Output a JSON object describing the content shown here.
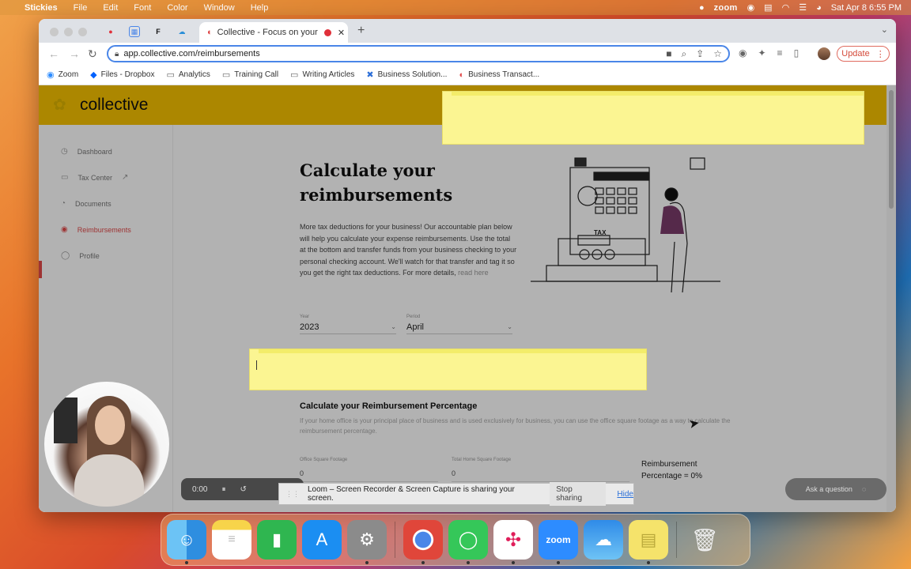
{
  "menubar": {
    "app": "Stickies",
    "items": [
      "File",
      "Edit",
      "Font",
      "Color",
      "Window",
      "Help"
    ],
    "zoom": "zoom",
    "datetime": "Sat Apr 8  6:55 PM"
  },
  "browser": {
    "tab_title": "Collective - Focus on your",
    "url": "app.collective.com/reimbursements",
    "update_label": "Update",
    "bookmarks": [
      "Zoom",
      "Files - Dropbox",
      "Analytics",
      "Training Call",
      "Writing Articles",
      "Business Solution...",
      "Business Transact..."
    ]
  },
  "app": {
    "logo": "collective",
    "nav": [
      "Dashboard",
      "Tax Center",
      "Documents",
      "Reimbursements",
      "Profile"
    ],
    "heading": "Calculate your reimbursements",
    "intro": "More tax deductions for your business! Our accountable plan below will help you calculate your expense reimbursements. Use the total at the bottom and transfer funds from your business checking to your personal checking account. We'll watch for that transfer and tag it so you get the right tax deductions. For more details,",
    "intro_link": "read here",
    "year_label": "Year",
    "year_value": "2023",
    "period_label": "Period",
    "period_value": "April",
    "section_title": "Calculate your Reimbursement Percentage",
    "section_text": "If your home office is your principal place of business and is used exclusively for business, you can use the office square footage as a way to calculate the reimbursement percentage.",
    "office_label": "Office Square Footage",
    "office_value": "0",
    "home_label": "Total Home Square Footage",
    "home_value": "0",
    "reimb_label": "Reimbursement",
    "reimb_value": "Percentage = 0%",
    "ask_label": "Ask a question"
  },
  "loom": {
    "time": "0:00",
    "message": "Loom – Screen Recorder & Screen Capture is sharing your screen.",
    "stop_label": "Stop sharing",
    "hide_label": "Hide"
  },
  "dock": {
    "apps": [
      "Finder",
      "Notes",
      "Numbers",
      "App Store",
      "System Settings",
      "Chrome",
      "Messages",
      "Slack",
      "Zoom",
      "iCloud",
      "Stickies",
      "Trash"
    ],
    "zoom_label": "zoom"
  },
  "colors": {
    "brand_yellow": "#f6c200",
    "sticky_yellow": "#fbf592",
    "accent_red": "#e24a4a",
    "link_blue": "#2a6fd8"
  }
}
